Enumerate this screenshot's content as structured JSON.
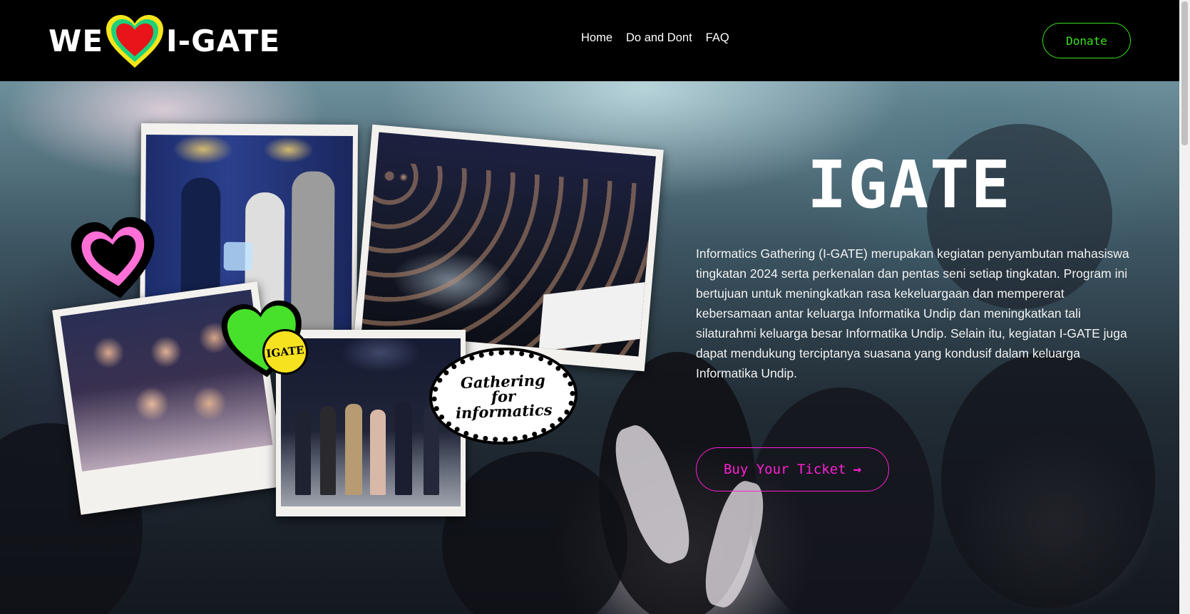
{
  "header": {
    "logo_left": "WE",
    "logo_right": "I-GATE",
    "nav": [
      {
        "label": "Home"
      },
      {
        "label": "Do and Dont"
      },
      {
        "label": "FAQ"
      }
    ],
    "donate_label": "Donate"
  },
  "hero": {
    "title": "IGATE",
    "description": "Informatics Gathering (I-GATE) merupakan kegiatan penyambutan mahasiswa tingkatan 2024 serta perkenalan dan pentas seni setiap tingkatan. Program ini bertujuan untuk meningkatkan rasa kekeluargaan dan mempererat kebersamaan antar keluarga Informatika Undip dan meningkatkan tali silaturahmi keluarga besar Informatika Undip. Selain itu, kegiatan I-GATE juga dapat mendukung terciptanya suasana yang kondusif dalam keluarga Informatika Undip.",
    "ticket_label": "Buy Your Ticket",
    "ticket_arrow": "→",
    "sticker_igate": "IGATE",
    "sticker_gathering_line1": "Gathering",
    "sticker_gathering_line2": "for",
    "sticker_gathering_line3": "informatics"
  },
  "colors": {
    "donate_accent": "#3be31d",
    "ticket_accent": "#ff1fd3",
    "header_bg": "#000000"
  }
}
